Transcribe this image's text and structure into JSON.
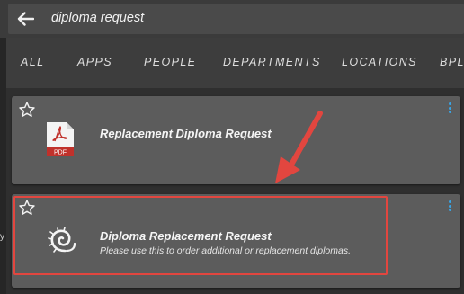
{
  "search": {
    "query": "diploma request"
  },
  "tabs": [
    {
      "label": "ALL"
    },
    {
      "label": "APPS"
    },
    {
      "label": "PEOPLE"
    },
    {
      "label": "DEPARTMENTS"
    },
    {
      "label": "LOCATIONS"
    },
    {
      "label": "BPL"
    }
  ],
  "results": [
    {
      "title": "Replacement Diploma Request",
      "description": "",
      "icon": "pdf-document-icon",
      "icon_label": "PDF"
    },
    {
      "title": "Diploma Replacement Request",
      "description": "Please use this to order additional or replacement diplomas.",
      "icon": "nautilus-shell-icon"
    }
  ],
  "edge_text": "y",
  "colors": {
    "accent": "#3aa3e3",
    "annotation": "#e2463f",
    "card": "#5c5c5c",
    "background": "#2e2e2e",
    "pdf_red": "#c0312b"
  }
}
